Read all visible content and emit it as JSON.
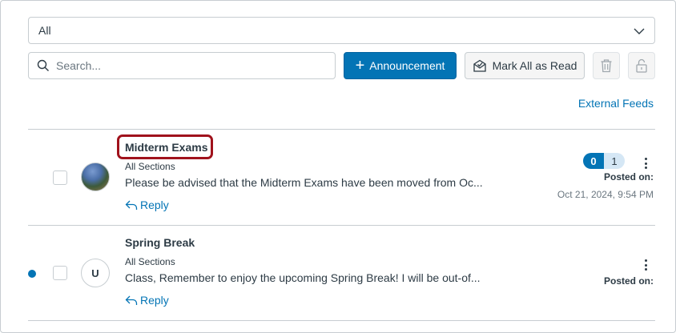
{
  "filter": {
    "selected": "All"
  },
  "search": {
    "placeholder": "Search..."
  },
  "toolbar": {
    "announcement_label": "Announcement",
    "mark_all_read_label": "Mark All as Read",
    "external_feeds_label": "External Feeds"
  },
  "announcements": [
    {
      "title": "Midterm Exams",
      "sections": "All Sections",
      "message": "Please be advised that the Midterm Exams have been moved from Oc...",
      "reply_label": "Reply",
      "unread_count": "0",
      "total_count": "1",
      "posted_label": "Posted on:",
      "posted_date": "Oct 21, 2024, 9:54 PM",
      "avatar": "profile-photo",
      "unread": false
    },
    {
      "title": "Spring Break",
      "sections": "All Sections",
      "message": "Class, Remember to enjoy the upcoming Spring Break! I will be out-of...",
      "reply_label": "Reply",
      "posted_label": "Posted on:",
      "avatar_initial": "U",
      "unread": true
    }
  ],
  "colors": {
    "primary": "#0374b5",
    "highlight": "#a0121c",
    "text": "#2d3b45",
    "border": "#c7cdd1"
  }
}
